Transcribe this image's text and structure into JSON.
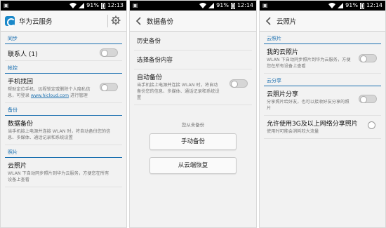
{
  "status": {
    "battery_pct": "91%",
    "time1": "12:13",
    "time2": "12:14",
    "time3": "12:14"
  },
  "screen1": {
    "title": "华为云服务",
    "sections": [
      {
        "header": "同步"
      },
      {
        "header": "帐控"
      },
      {
        "header": "备份"
      },
      {
        "header": "照片"
      }
    ],
    "contacts": {
      "label": "联系人 (1)"
    },
    "find_phone": {
      "label": "手机找回",
      "desc_prefix": "帮助定位手机、远程锁定或删除个人隐私信息，可登录 ",
      "link": "www.hicloud.com",
      "desc_suffix": " 进行管理"
    },
    "backup": {
      "label": "数据备份",
      "desc": "当手机接上电源并连接 WLAN 时，将自动备份您的信息、多媒体、通话记录和系统设置"
    },
    "cloud_photos": {
      "label": "云照片",
      "desc": "WLAN 下自动同步照片到华为云服务，方便您在所有设备上查看"
    }
  },
  "screen2": {
    "title": "数据备份",
    "history": "历史备份",
    "choose_content": "选择备份内容",
    "auto_backup": {
      "label": "自动备份",
      "desc": "当手机接上电源并连接 WLAN 时，将自动备份您的信息、多媒体、通话记录和系统设置"
    },
    "not_backed_up": "您从未备份",
    "manual_backup": "手动备份",
    "restore_cloud": "从云端恢复"
  },
  "screen3": {
    "title": "云照片",
    "section_cloud": "云照片",
    "my_photos": {
      "label": "我的云照片",
      "desc": "WLAN 下自动同步照片到华为云服务，方便您在所有设备上查看"
    },
    "section_share": "云分享",
    "photo_share": {
      "label": "云照片分享",
      "desc": "分享照片给好友，也可以接收好友分享的照片"
    },
    "mobile_data": {
      "label": "允许使用3G及以上网络分享照片",
      "desc": "使用时可能会消耗较大流量"
    }
  }
}
